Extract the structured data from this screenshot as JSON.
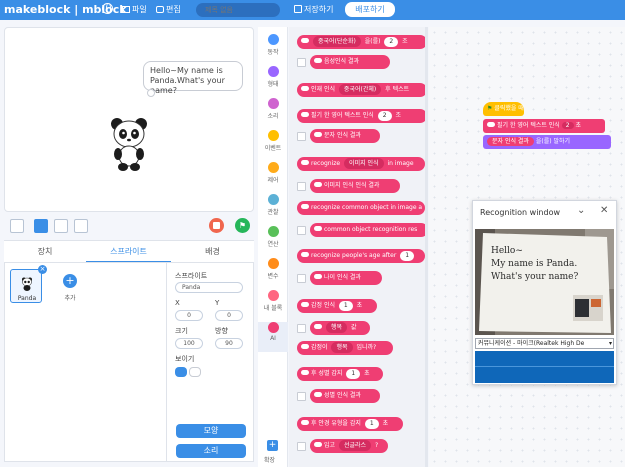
{
  "app": {
    "brand": "makeblock | mblock"
  },
  "menu": {
    "file": "파일",
    "edit": "편집"
  },
  "project": {
    "placeholder": "제목 없음"
  },
  "toolbar": {
    "save": "저장하기",
    "publish": "배포하기"
  },
  "stage": {
    "speech": "Hello~My name is Panda.What's your name?",
    "go_flag": "⚑"
  },
  "tabs": {
    "device": "장치",
    "sprites": "스프라이트",
    "background": "배경"
  },
  "sprite_list": {
    "sprite_name": "Panda",
    "delete": "×",
    "add_icon": "+",
    "add_label": "추가"
  },
  "props": {
    "sprite_label": "스프라이트",
    "sprite_value": "Panda",
    "x_label": "X",
    "x_value": "0",
    "y_label": "Y",
    "y_value": "0",
    "size_label": "크기",
    "size_value": "100",
    "dir_label": "방향",
    "dir_value": "90",
    "show_label": "보이기",
    "look_button": "모양",
    "sound_button": "소리"
  },
  "categories": [
    {
      "label": "동작",
      "color": "#4c97ff"
    },
    {
      "label": "형태",
      "color": "#9966ff"
    },
    {
      "label": "소리",
      "color": "#cf63cf"
    },
    {
      "label": "이벤트",
      "color": "#ffbf00"
    },
    {
      "label": "제어",
      "color": "#ffab19"
    },
    {
      "label": "관찰",
      "color": "#5cb1d6"
    },
    {
      "label": "연산",
      "color": "#59c059"
    },
    {
      "label": "변수",
      "color": "#ff8c1a"
    },
    {
      "label": "내 블록",
      "color": "#ff6680"
    },
    {
      "label": "AI",
      "color": "#ef3e73"
    }
  ],
  "extension": {
    "icon": "+",
    "label": "확장"
  },
  "blocks": [
    {
      "pre": "",
      "dd": "중국어(단순화)",
      "mid": "을(를)",
      "nb": "2",
      "post": "조"
    },
    {
      "pre": "음성인식 결과",
      "dd": "",
      "mid": "",
      "nb": "",
      "post": ""
    },
    {
      "pre": "인재 인식",
      "dd": "중국어(간체)",
      "mid": "후 텍스트",
      "nb": "",
      "post": ""
    },
    {
      "pre": "필기 한 영어 텍스트 인식",
      "dd": "",
      "mid": "",
      "nb": "2",
      "post": "조"
    },
    {
      "pre": "문자 인식 결과",
      "dd": "",
      "mid": "",
      "nb": "",
      "post": ""
    },
    {
      "pre": "recognize",
      "dd": "이미지 인식",
      "mid": "in image",
      "nb": "",
      "post": ""
    },
    {
      "pre": "이미지 인식",
      "dd": "",
      "mid": "인식 결과",
      "nb": "",
      "post": ""
    },
    {
      "pre": "recognize common object in image a",
      "dd": "",
      "mid": "",
      "nb": "",
      "post": ""
    },
    {
      "pre": "common object recognition res",
      "dd": "",
      "mid": "",
      "nb": "",
      "post": ""
    },
    {
      "pre": "recognize people's age after",
      "dd": "",
      "mid": "",
      "nb": "1",
      "post": ""
    },
    {
      "pre": "나이 인식 결과",
      "dd": "",
      "mid": "",
      "nb": "",
      "post": ""
    },
    {
      "pre": "감정 인식",
      "dd": "",
      "mid": "",
      "nb": "1",
      "post": "초"
    },
    {
      "pre": "",
      "dd": "행복",
      "mid": "값",
      "nb": "",
      "post": ""
    },
    {
      "pre": "감정이",
      "dd": "행복",
      "mid": "입니까?",
      "nb": "",
      "post": ""
    },
    {
      "pre": "후 성별 감지",
      "dd": "",
      "mid": "",
      "nb": "1",
      "post": "초"
    },
    {
      "pre": "성별 인식 결과",
      "dd": "",
      "mid": "",
      "nb": "",
      "post": ""
    },
    {
      "pre": "후 안경 유형을 감지",
      "dd": "",
      "mid": "",
      "nb": "1",
      "post": "초"
    },
    {
      "pre": "입고",
      "dd": "선글라스",
      "mid": "?",
      "nb": "",
      "post": ""
    }
  ],
  "script": {
    "hat": "클릭했을 때",
    "step1": "필기 한 영어 텍스트 인식",
    "step1_num": "2",
    "step1_unit": "초",
    "step2_reporter": "문자 인식 결과",
    "step2": "을(를) 말하기"
  },
  "recognition": {
    "title": "Recognition window",
    "minimize": "⌄",
    "close": "✕",
    "board_text": "Hello~\nMy name is Panda.\nWhat's your name?",
    "device": "커뮤니케이션 - 마이크(Realtek High De"
  }
}
